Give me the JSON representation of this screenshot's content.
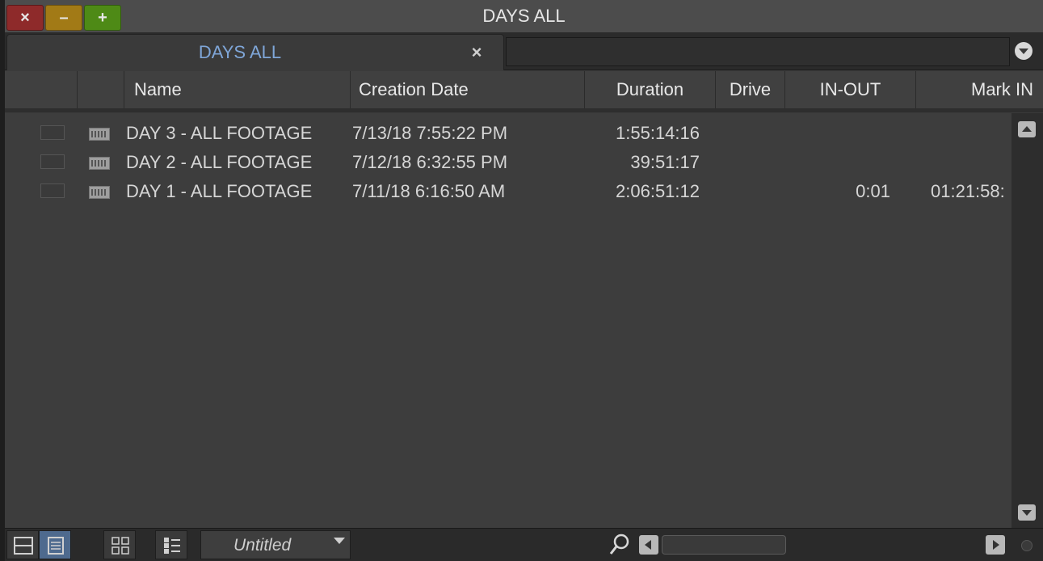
{
  "window": {
    "title": "DAYS ALL"
  },
  "tabs": [
    {
      "label": "DAYS ALL",
      "close": "×"
    }
  ],
  "columns": [
    {
      "label": ""
    },
    {
      "label": ""
    },
    {
      "label": "Name"
    },
    {
      "label": "Creation Date"
    },
    {
      "label": "Duration"
    },
    {
      "label": "Drive"
    },
    {
      "label": "IN-OUT"
    },
    {
      "label": "Mark IN"
    }
  ],
  "rows": [
    {
      "name": "DAY 3 - ALL FOOTAGE",
      "creation_date": "7/13/18 7:55:22 PM",
      "duration": "1:55:14:16",
      "drive": "",
      "in_out": "",
      "mark_in": ""
    },
    {
      "name": "DAY 2 - ALL FOOTAGE",
      "creation_date": "7/12/18 6:32:55 PM",
      "duration": "39:51:17",
      "drive": "",
      "in_out": "",
      "mark_in": ""
    },
    {
      "name": "DAY 1 - ALL FOOTAGE",
      "creation_date": "7/11/18 6:16:50 AM",
      "duration": "2:06:51:12",
      "drive": "",
      "in_out": "0:01",
      "mark_in": "01:21:58:"
    }
  ],
  "bottombar": {
    "view_name": "Untitled"
  },
  "icons": {
    "window_close": "×",
    "window_minimize": "–",
    "window_zoom": "+",
    "row_icon": "bin-icon",
    "search": "search-icon"
  },
  "colors": {
    "tab_label": "#7fa6d8",
    "close_btn": "#8e2a2a",
    "min_btn": "#a27a16",
    "max_btn": "#4e8a16",
    "active_view": "#4e6a8e"
  }
}
